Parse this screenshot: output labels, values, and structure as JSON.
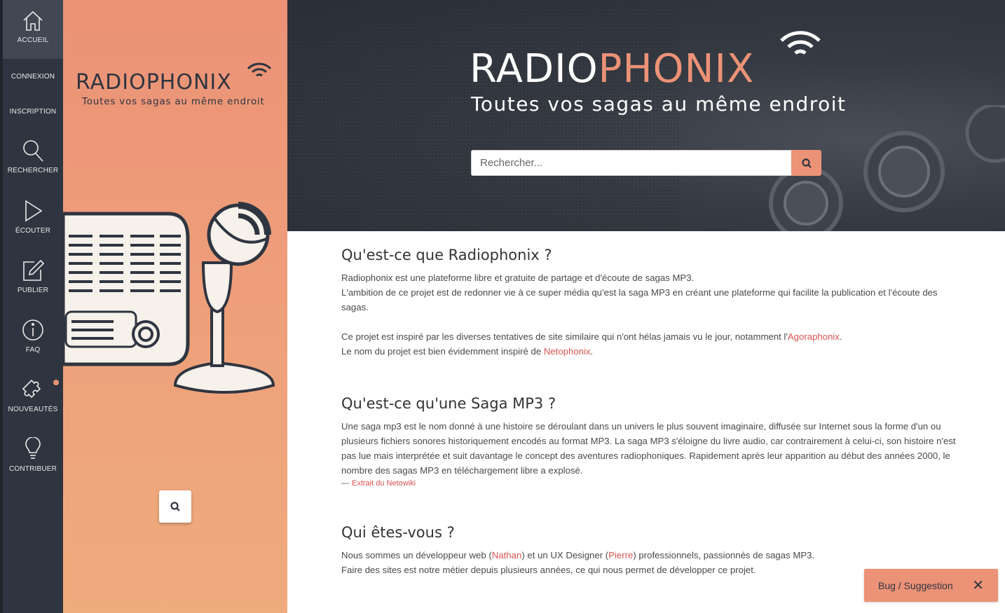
{
  "nav": {
    "items": [
      {
        "label": "ACCUEIL",
        "icon": "home-icon"
      },
      {
        "label": "CONNEXION"
      },
      {
        "label": "INSCRIPTION"
      },
      {
        "label": "RECHERCHER",
        "icon": "search-icon"
      },
      {
        "label": "ÉCOUTER",
        "icon": "play-icon"
      },
      {
        "label": "PUBLIER",
        "icon": "edit-icon"
      },
      {
        "label": "FAQ",
        "icon": "info-icon"
      },
      {
        "label": "NOUVEAUTÉS",
        "icon": "puzzle-icon"
      },
      {
        "label": "CONTRIBUER",
        "icon": "lightbulb-icon"
      }
    ]
  },
  "brand": {
    "radio": "RADIO",
    "phonix": "PHONIX",
    "tagline": "Toutes vos sagas au même endroit"
  },
  "search": {
    "placeholder": "Rechercher..."
  },
  "sections": {
    "what": {
      "title": "Qu'est-ce que Radiophonix ?",
      "line1": "Radiophonix est une plateforme libre et gratuite de partage et d'écoute de sagas MP3.",
      "line2": "L'ambition de ce projet est de redonner vie à ce super média qu'est la saga MP3 en créant une plateforme qui facilite la publication et l'écoute des sagas.",
      "line3_pre": "Ce projet est inspiré par les diverses tentatives de site similaire qui n'ont hélas jamais vu le jour, notamment l'",
      "line3_link": "Agoraphonix",
      "line3_post": ".",
      "line4_pre": "Le nom du projet est bien évidemment inspiré de ",
      "line4_link": "Netophonix",
      "line4_post": "."
    },
    "saga": {
      "title": "Qu'est-ce qu'une Saga MP3 ?",
      "text": "Une saga mp3 est le nom donné à une histoire se déroulant dans un univers le plus souvent imaginaire, diffusée sur Internet sous la forme d'un ou plusieurs fichiers sonores historiquement encodés au format MP3. La saga MP3 s'éloigne du livre audio, car contrairement à celui-ci, son histoire n'est pas lue mais interprétée et suit davantage le concept des aventures radiophoniques. Rapidement après leur apparition au début des années 2000, le nombre des sagas MP3 en téléchargement libre a explosé.",
      "cite_dash": "—",
      "cite": "Extrait du Netowiki"
    },
    "who": {
      "title": "Qui êtes-vous ?",
      "l1_a": "Nous sommes un développeur web (",
      "l1_link1": "Nathan",
      "l1_b": ") et un UX Designer (",
      "l1_link2": "Pierre",
      "l1_c": ") professionnels, passionnés de sagas MP3.",
      "l2": "Faire des sites est notre métier depuis plusieurs années, ce qui nous permet de développer ce projet."
    }
  },
  "bug": {
    "label": "Bug / Suggestion",
    "close": "✕"
  },
  "colors": {
    "accent": "#ec9277",
    "nav_bg": "#2f3540",
    "link": "#d9534f"
  }
}
